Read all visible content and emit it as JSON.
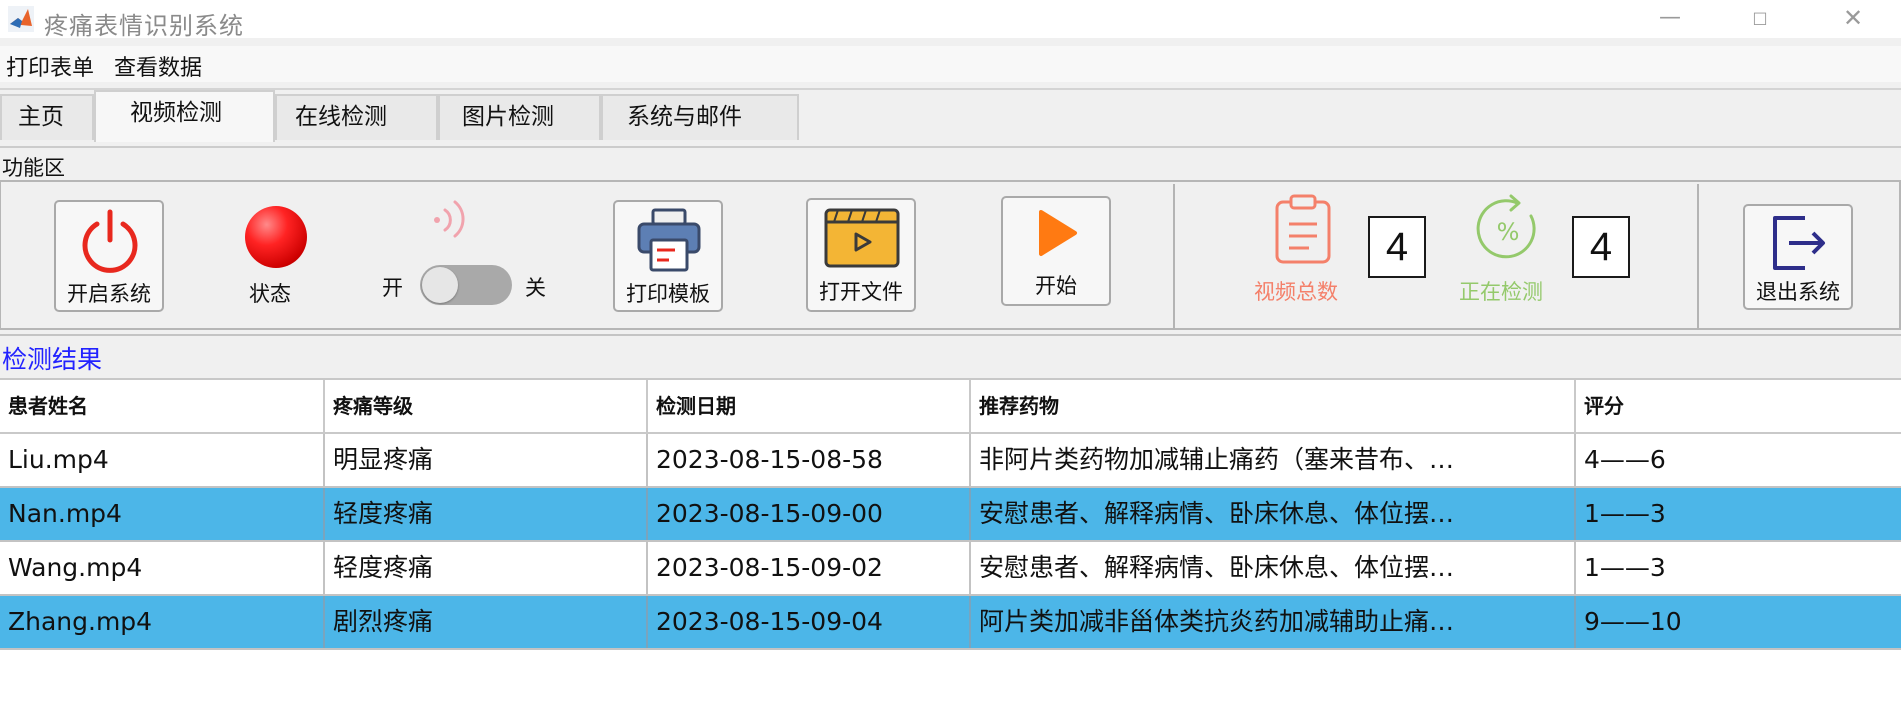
{
  "window": {
    "title": "疼痛表情识别系统",
    "controls": {
      "minimize": "—",
      "maximize": "□",
      "close": "✕"
    }
  },
  "menubar": {
    "items": [
      "打印表单",
      "查看数据"
    ]
  },
  "tabs": [
    {
      "label": "主页",
      "active": false
    },
    {
      "label": "视频检测",
      "active": true
    },
    {
      "label": "在线检测",
      "active": false
    },
    {
      "label": "图片检测",
      "active": false
    },
    {
      "label": "系统与邮件",
      "active": false
    }
  ],
  "function_area": {
    "label": "功能区",
    "start_system_label": "开启系统",
    "status_label": "状态",
    "toggle": {
      "on_label": "开",
      "off_label": "关",
      "state": "off"
    },
    "print_template_label": "打印模板",
    "open_file_label": "打开文件",
    "start_label": "开始",
    "video_total_label": "视频总数",
    "video_total_value": "4",
    "detecting_label": "正在检测",
    "detecting_value": "4",
    "exit_label": "退出系统"
  },
  "colors": {
    "status_red": "#ff2323",
    "video_total_color": "#f4806a",
    "detecting_color": "#94c96b",
    "results_label_color": "#2222ff",
    "selected_row": "#4cb6e8"
  },
  "results": {
    "label": "检测结果",
    "columns": [
      "患者姓名",
      "疼痛等级",
      "检测日期",
      "推荐药物",
      "评分"
    ],
    "rows": [
      {
        "name": "Liu.mp4",
        "level": "明显疼痛",
        "date": "2023-08-15-08-58",
        "drug": "非阿片类药物加减辅止痛药（塞来昔布、…",
        "score": "4——6",
        "selected": false
      },
      {
        "name": "Nan.mp4",
        "level": "轻度疼痛",
        "date": "2023-08-15-09-00",
        "drug": "安慰患者、解释病情、卧床休息、体位摆…",
        "score": "1——3",
        "selected": true
      },
      {
        "name": "Wang.mp4",
        "level": "轻度疼痛",
        "date": "2023-08-15-09-02",
        "drug": "安慰患者、解释病情、卧床休息、体位摆…",
        "score": "1——3",
        "selected": false
      },
      {
        "name": "Zhang.mp4",
        "level": "剧烈疼痛",
        "date": "2023-08-15-09-04",
        "drug": "阿片类加减非甾体类抗炎药加减辅助止痛…",
        "score": "9——10",
        "selected": true
      }
    ]
  }
}
